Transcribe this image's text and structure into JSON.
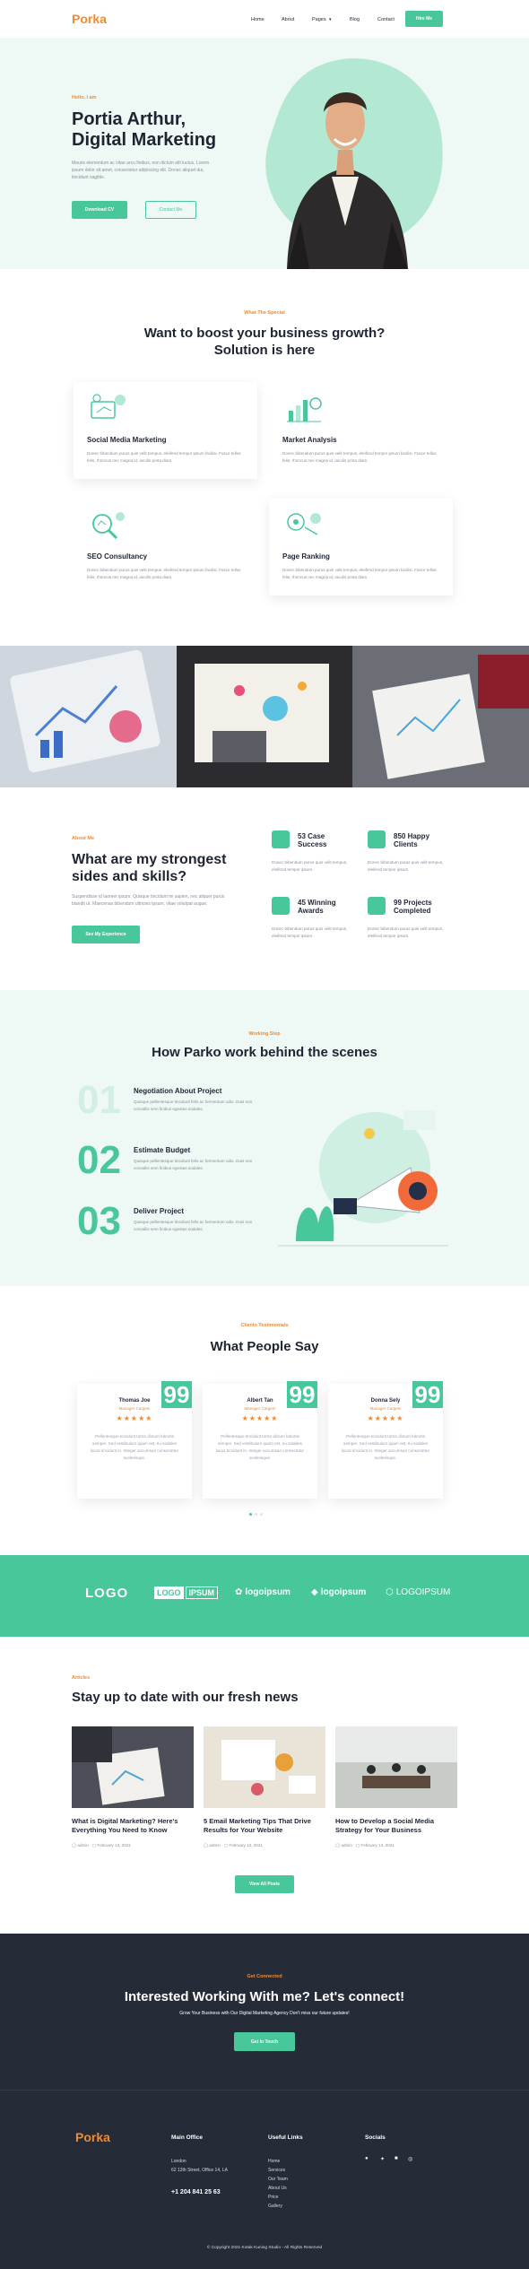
{
  "nav": {
    "logo": "Porka",
    "items": [
      "Home",
      "About",
      "Pages",
      "Blog",
      "Contact"
    ],
    "pages_caret": "▾",
    "cta": "Hire Me"
  },
  "hero": {
    "eyebrow": "Hello, I am",
    "title_line1": "Portia Arthur,",
    "title_line2": "Digital Marketing",
    "desc": "Mauris elementum ac vitae arcu finibus, non dictum elit luctus. Lorem ipsum dolor sit amet, consectetur adipiscing elit. Donec aliquet dui, tincidunt sagittis.",
    "btn_primary": "Download CV",
    "btn_secondary": "Contact Me"
  },
  "services": {
    "eyebrow": "What The Special",
    "title_line1": "Want to boost your business growth?",
    "title_line2": "Solution is here",
    "items": [
      {
        "title": "Social Media Marketing",
        "text": "Donec bibendum purus quis velit tempus, eleifend tempor ipsum facilisi. Fusce tellus felis, rhoncus nec magna id, iaculis porta diam."
      },
      {
        "title": "Market Analysis",
        "text": "Donec bibendum purus quis velit tempus, eleifend tempor ipsum facilisi. Fusce tellus felis, rhoncus nec magna id, iaculis porta diam."
      },
      {
        "title": "SEO Consultancy",
        "text": "Donec bibendum purus quis velit tempus, eleifend tempor ipsum facilisi. Fusce tellus felis, rhoncus nec magna id, iaculis porta diam."
      },
      {
        "title": "Page Ranking",
        "text": "Donec bibendum purus quis velit tempus, eleifend tempor ipsum facilisi. Fusce tellus felis, rhoncus nec magna id, iaculis porta diam."
      }
    ]
  },
  "about": {
    "eyebrow": "About Me",
    "title_line1": "What are my strongest",
    "title_line2": "sides and skills?",
    "desc": "Suspendisse id laoreet ipsum. Quisque tincidunt mi sapien, nec aliquet purus blandit ut. Maecenas bibendum ultricies ipsum, vitae volutpat augue.",
    "btn": "See My Experience",
    "stats": [
      {
        "l1": "53 Case",
        "l2": "Success",
        "text": "Donec bibendum purus quis velit tempus, eleifend tempor ipsum."
      },
      {
        "l1": "850 Happy",
        "l2": "Clients",
        "text": "Donec bibendum purus quis velit tempus, eleifend tempor ipsum."
      },
      {
        "l1": "45 Winning",
        "l2": "Awards",
        "text": "Donec bibendum purus quis velit tempus, eleifend tempor ipsum."
      },
      {
        "l1": "99 Projects",
        "l2": "Completed",
        "text": "Donec bibendum purus quis velit tempus, eleifend tempor ipsum."
      }
    ]
  },
  "process": {
    "eyebrow": "Working Step",
    "title": "How Parko work behind the scenes",
    "steps": [
      {
        "num": "01",
        "title": "Negotiation About Project",
        "text": "Quisque pellentesque tincidunt felis ac fermentum odio. Duis non convallis sem finibus egestas sodales."
      },
      {
        "num": "02",
        "title": "Estimate Budget",
        "text": "Quisque pellentesque tincidunt felis ac fermentum odio. Duis non convallis sem finibus egestas sodales."
      },
      {
        "num": "03",
        "title": "Deliver Project",
        "text": "Quisque pellentesque tincidunt felis ac fermentum odio. Duis non convallis sem finibus egestas sodales."
      }
    ]
  },
  "testimonials": {
    "eyebrow": "Clients Testimonials",
    "title": "What People Say",
    "stars": "★★★★★",
    "quote_mark": "99",
    "items": [
      {
        "name": "Thomas Joe",
        "role": "Manager Cargem",
        "quote": "Pellentesque tincidunt tortor dictum lobortis semper. Sed vestibulum quam est, eu sodales lacus tincidunt in. Integer accumsan consectetur scelerisque."
      },
      {
        "name": "Albert Tan",
        "role": "Manager Cargem",
        "quote": "Pellentesque tincidunt tortor dictum lobortis semper. Sed vestibulum quam est, eu sodales lacus tincidunt in. Integer accumsan consectetur scelerisque."
      },
      {
        "name": "Donna Sely",
        "role": "Manager Cargem",
        "quote": "Pellentesque tincidunt tortor dictum lobortis semper. Sed vestibulum quam est, eu sodales lacus tincidunt in. Integer accumsan consectetur scelerisque."
      }
    ]
  },
  "logos": [
    "LOGO",
    "LOGO",
    "IPSUM",
    "logoipsum",
    "logoipsum",
    "LOGOIPSUM"
  ],
  "articles": {
    "eyebrow": "Articles",
    "title": "Stay up to date with our fresh news",
    "btn": "View All Posts",
    "items": [
      {
        "title": "What is Digital Marketing? Here's Everything You Need to Know",
        "author": "admin",
        "date": "February 13, 2021"
      },
      {
        "title": "5 Email Marketing Tips That Drive Results for Your Website",
        "author": "admin",
        "date": "February 13, 2021"
      },
      {
        "title": "How to Develop a Social Media Strategy for Your Business",
        "author": "admin",
        "date": "February 13, 2021"
      }
    ]
  },
  "cta": {
    "eyebrow": "Get Connected",
    "title": "Interested Working With me? Let's connect!",
    "desc": "Grow Your Business with Our Digital Marketing Agency Don't miss our future updates!",
    "btn": "Get In Touch"
  },
  "footer": {
    "logo": "Porka",
    "office_title": "Main Office",
    "office_city": "London",
    "office_address": "62 12th Street, Office 14, LA",
    "office_phone": "+1 204 841 25 63",
    "links_title": "Useful Links",
    "links": [
      "Home",
      "Services",
      "Our Team",
      "About Us",
      "Price",
      "Gallery"
    ],
    "social_title": "Socials",
    "copyright": "© Copyright 2021 Kotak Kuning Studio - All Rights Reserved"
  },
  "colors": {
    "accent": "#48c79b",
    "orange": "#f28a2f",
    "dark": "#262b38",
    "hero_bg": "#eef8f4"
  }
}
